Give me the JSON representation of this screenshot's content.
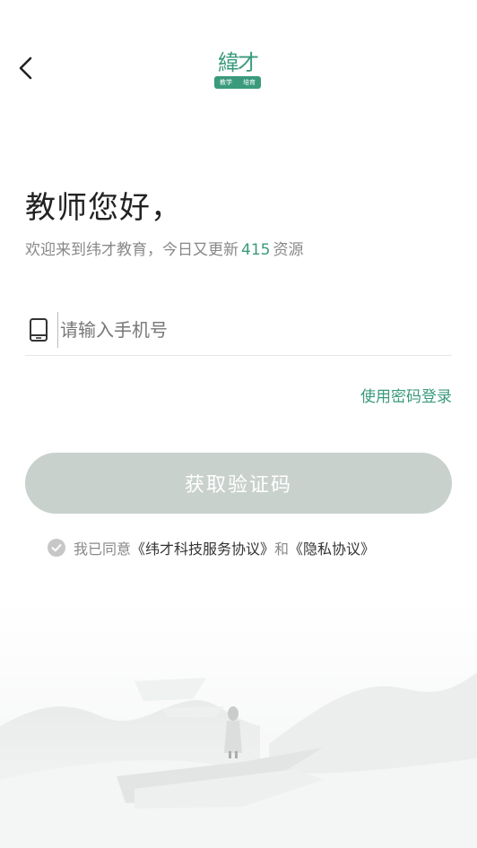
{
  "header": {
    "logo_text": "緯才",
    "logo_tag_left": "教学",
    "logo_tag_right": "培育"
  },
  "greeting": "教师您好，",
  "welcome": {
    "prefix": "欢迎来到纬才教育，今日又更新",
    "count": "415",
    "suffix": "资源"
  },
  "phone_input": {
    "placeholder": "请输入手机号",
    "value": ""
  },
  "password_login_label": "使用密码登录",
  "get_code_label": "获取验证码",
  "agreement": {
    "prefix": "我已同意",
    "service_link": "《纬才科技服务协议》",
    "connector": "和",
    "privacy_link": "《隐私协议》"
  },
  "colors": {
    "accent": "#3a9a7c",
    "button_disabled": "#c9d1cd",
    "hint": "#888888"
  }
}
